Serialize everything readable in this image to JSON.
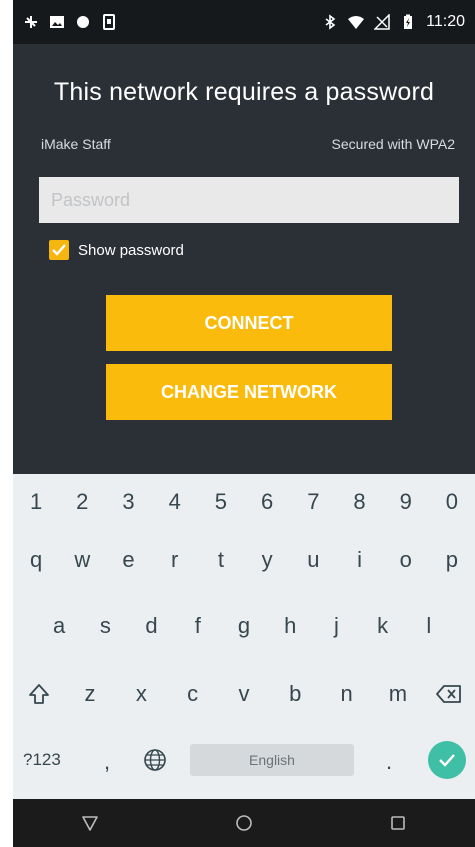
{
  "status_bar": {
    "left_icons": [
      "cast-icon",
      "image-icon",
      "circle-icon",
      "sim-icon"
    ],
    "right_icons": [
      "bluetooth-icon",
      "wifi-icon",
      "signal-icon",
      "battery-icon"
    ],
    "time": "11:20"
  },
  "dialog": {
    "title": "This network requires a password",
    "network_name": "iMake Staff",
    "security": "Secured with WPA2",
    "password": {
      "value": "",
      "placeholder": "Password"
    },
    "show_password": {
      "label": "Show password",
      "checked": true
    },
    "buttons": {
      "connect": "CONNECT",
      "change_network": "CHANGE NETWORK"
    },
    "accent_color": "#fbbb0d"
  },
  "keyboard": {
    "number_row": [
      "1",
      "2",
      "3",
      "4",
      "5",
      "6",
      "7",
      "8",
      "9",
      "0"
    ],
    "row1": [
      "q",
      "w",
      "e",
      "r",
      "t",
      "y",
      "u",
      "i",
      "o",
      "p"
    ],
    "row2": [
      "a",
      "s",
      "d",
      "f",
      "g",
      "h",
      "j",
      "k",
      "l"
    ],
    "row3": [
      "z",
      "x",
      "c",
      "v",
      "b",
      "n",
      "m"
    ],
    "symbols_label": "?123",
    "comma": ",",
    "period": ".",
    "space_label": "English",
    "enter_color": "#3fbfa5"
  },
  "nav_bar": {
    "icons": [
      "back-icon",
      "home-icon",
      "recents-icon"
    ]
  }
}
